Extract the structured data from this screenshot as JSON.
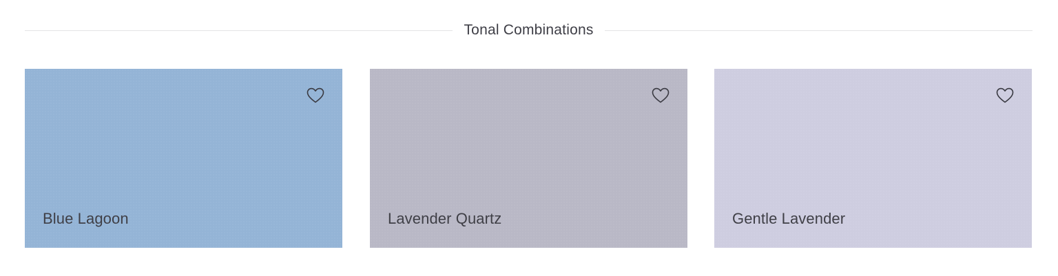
{
  "section": {
    "title": "Tonal Combinations"
  },
  "cards": [
    {
      "name": "Blue Lagoon",
      "color": "#94b4d6",
      "favorite_icon": "heart-outline-icon"
    },
    {
      "name": "Lavender Quartz",
      "color": "#b9b8c6",
      "favorite_icon": "heart-outline-icon"
    },
    {
      "name": "Gentle Lavender",
      "color": "#cecde0",
      "favorite_icon": "heart-outline-icon"
    }
  ]
}
